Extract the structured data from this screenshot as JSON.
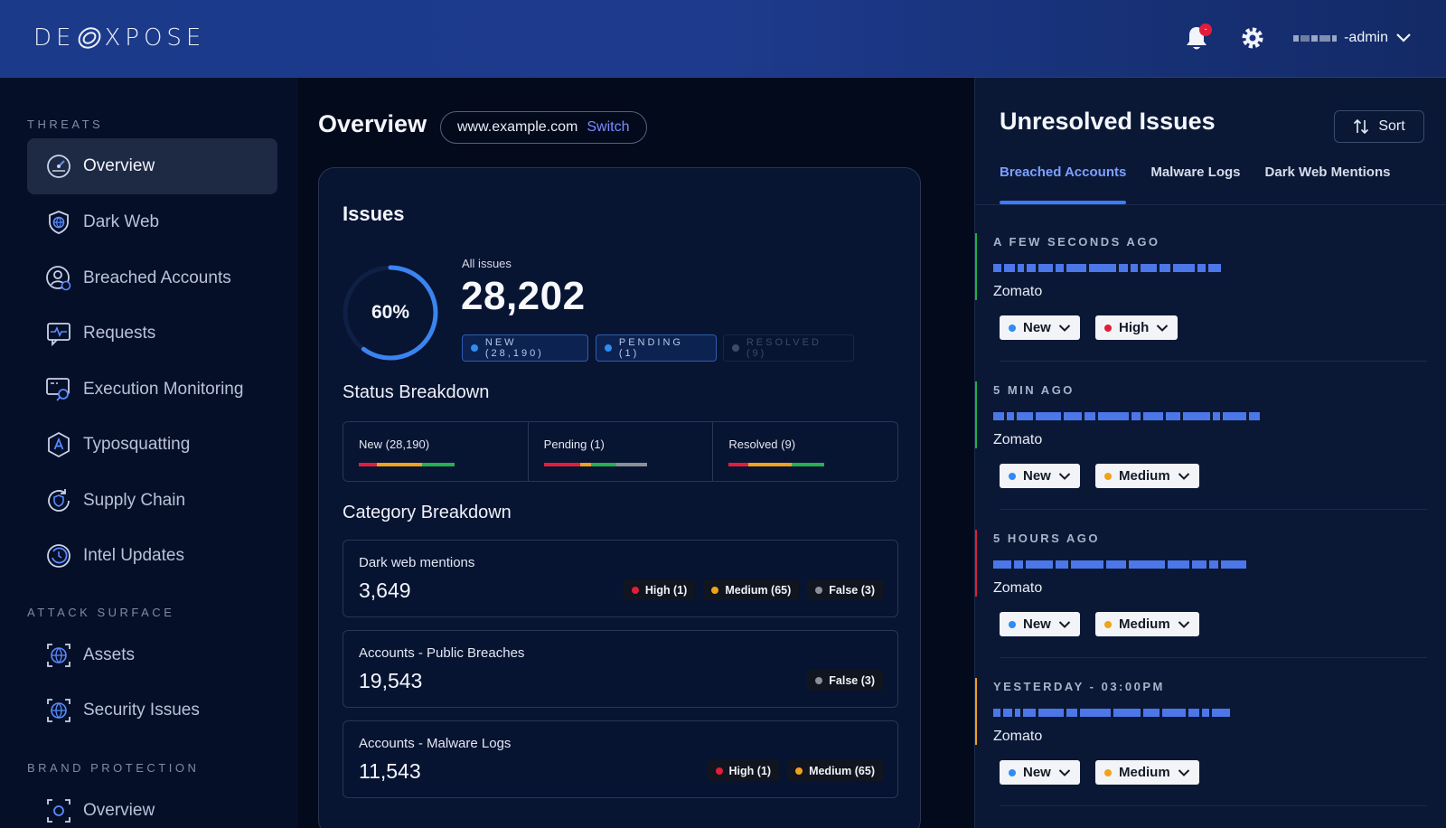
{
  "header": {
    "logo_text": "DEXPOSE",
    "notification_badge": "-",
    "username": "-admin"
  },
  "sidebar": {
    "sections": {
      "threats": "THREATS",
      "attack_surface": "ATTACK SURFACE",
      "brand_protection": "BRAND PROTECTION"
    },
    "items": [
      {
        "label": "Overview",
        "icon": "speedometer-icon",
        "active": true
      },
      {
        "label": "Dark Web",
        "icon": "shield-globe-icon"
      },
      {
        "label": "Breached Accounts",
        "icon": "user-lock-icon"
      },
      {
        "label": "Requests",
        "icon": "pulse-message-icon"
      },
      {
        "label": "Execution Monitoring",
        "icon": "monitor-search-icon"
      },
      {
        "label": "Typosquatting",
        "icon": "hexagon-letter-icon"
      },
      {
        "label": "Supply Chain",
        "icon": "cycle-shield-icon"
      },
      {
        "label": "Intel Updates",
        "icon": "refresh-clock-icon"
      },
      {
        "label": "Assets",
        "icon": "globe-frame-icon"
      },
      {
        "label": "Security Issues",
        "icon": "globe-frame-icon"
      },
      {
        "label": "Overview",
        "icon": "gear-frame-icon"
      }
    ]
  },
  "main": {
    "title": "Overview",
    "domain": "www.example.com",
    "switch_label": "Switch",
    "issues": {
      "title": "Issues",
      "progress_percent": 60,
      "progress_label": "60%",
      "all_label": "All issues",
      "all_value": "28,202",
      "chips": {
        "new": "NEW (28,190)",
        "pending": "PENDING (1)",
        "resolved": "RESOLVED (9)"
      }
    },
    "status_breakdown": {
      "title": "Status Breakdown",
      "cells": [
        "New (28,190)",
        "Pending (1)",
        "Resolved (9)"
      ]
    },
    "category_breakdown": {
      "title": "Category Breakdown",
      "items": [
        {
          "name": "Dark web mentions",
          "value": "3,649",
          "tags": [
            "High (1)",
            "Medium (65)",
            "False (3)"
          ]
        },
        {
          "name": "Accounts - Public Breaches",
          "value": "19,543",
          "tags": [
            "False (3)"
          ]
        },
        {
          "name": "Accounts - Malware Logs",
          "value": "11,543",
          "tags": [
            "High (1)",
            "Medium (65)"
          ]
        }
      ]
    }
  },
  "right_panel": {
    "title": "Unresolved Issues",
    "sort_label": "Sort",
    "tabs": [
      "Breached Accounts",
      "Malware Logs",
      "Dark Web Mentions"
    ],
    "issues": [
      {
        "when": "A FEW SECONDS AGO",
        "source": "Zomato",
        "status": "New",
        "severity": "High",
        "accent": "#1fae4f"
      },
      {
        "when": "5 MIN AGO",
        "source": "Zomato",
        "status": "New",
        "severity": "Medium",
        "accent": "#1fae4f"
      },
      {
        "when": "5 HOURS AGO",
        "source": "Zomato",
        "status": "New",
        "severity": "Medium",
        "accent": "#d2233e"
      },
      {
        "when": "YESTERDAY -  03:00PM",
        "source": "Zomato",
        "status": "New",
        "severity": "Medium",
        "accent": "#e8a21f"
      }
    ]
  },
  "colors": {
    "new": "#2f8cf2",
    "high": "#e21d3a",
    "medium": "#f1a21b",
    "false": "#8a8f99",
    "accent_tab": "#3d7bfa"
  }
}
